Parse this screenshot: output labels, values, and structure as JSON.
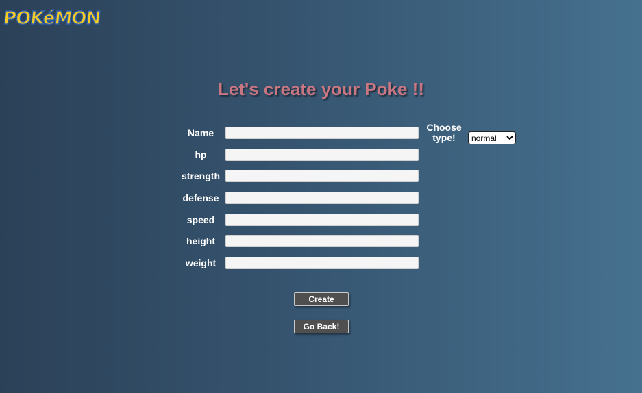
{
  "header": {
    "logo_text": "POKéMON"
  },
  "page": {
    "title": "Let's create your Poke !!"
  },
  "form": {
    "fields": [
      {
        "label": "Name",
        "value": ""
      },
      {
        "label": "hp",
        "value": ""
      },
      {
        "label": "strength",
        "value": ""
      },
      {
        "label": "defense",
        "value": ""
      },
      {
        "label": "speed",
        "value": ""
      },
      {
        "label": "height",
        "value": ""
      },
      {
        "label": "weight",
        "value": ""
      }
    ],
    "type_label_line1": "Choose",
    "type_label_line2": "type!",
    "type_selected": "normal",
    "create_label": "Create",
    "back_label": "Go Back!"
  },
  "colors": {
    "title": "#c97683",
    "logo_fill": "#f6cb24",
    "logo_outline": "#2f5da8",
    "button_bg": "#4f4f50"
  }
}
